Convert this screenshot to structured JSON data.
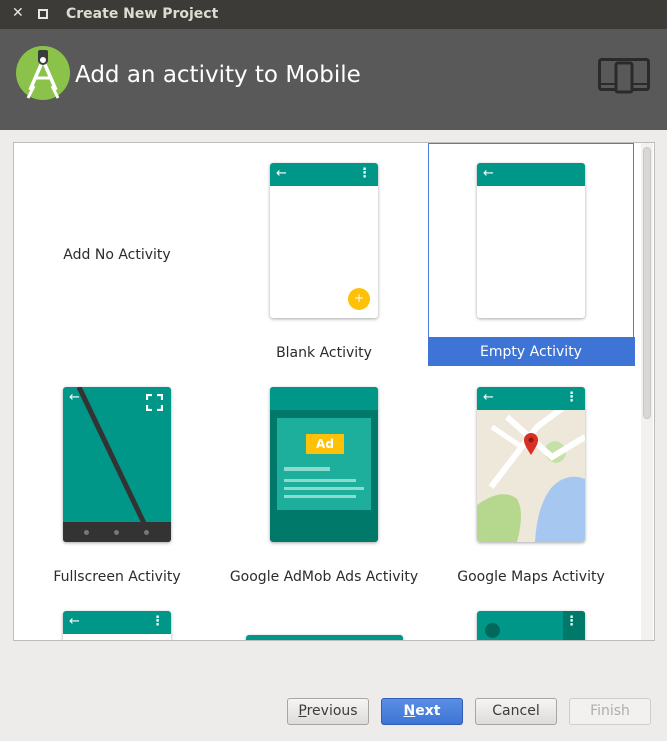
{
  "window": {
    "title": "Create New Project",
    "close_glyph": "✕"
  },
  "header": {
    "heading": "Add an activity to Mobile",
    "logo_icon": "android-studio-icon",
    "device_icon": "phone-tablet-icon"
  },
  "colors": {
    "teal": "#009688",
    "dark_teal": "#00796b",
    "selection_blue": "#3e74d5",
    "fab_yellow": "#ffc107",
    "ad_yellow": "#ffc107"
  },
  "activities": [
    {
      "label": "Add No Activity"
    },
    {
      "label": "Blank Activity",
      "fab": "+"
    },
    {
      "label": "Empty Activity",
      "selected": true
    },
    {
      "label": "Fullscreen Activity"
    },
    {
      "label": "Google AdMob Ads Activity",
      "badge": "Ad"
    },
    {
      "label": "Google Maps Activity"
    }
  ],
  "buttons": {
    "previous": {
      "underline": "P",
      "rest": "revious"
    },
    "next": {
      "underline": "N",
      "rest": "ext"
    },
    "cancel": "Cancel",
    "finish": "Finish"
  }
}
